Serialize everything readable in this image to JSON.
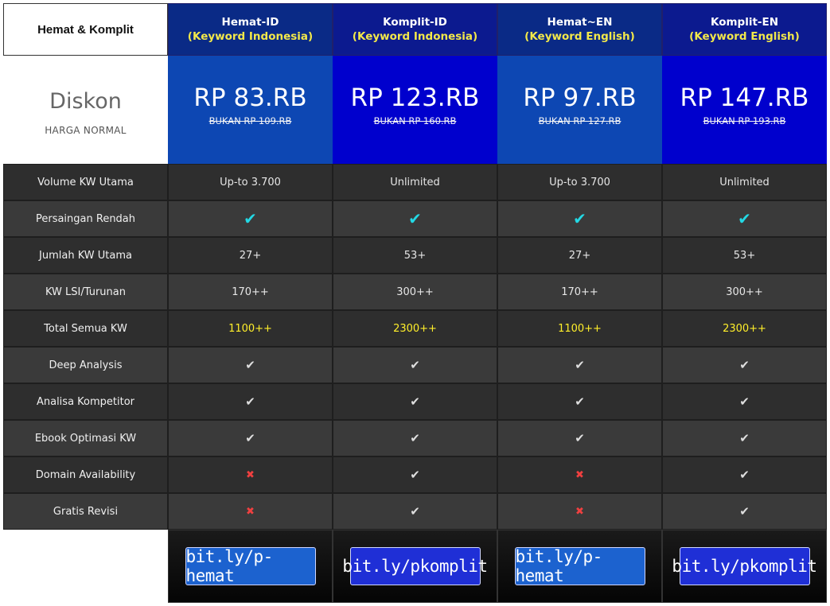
{
  "table": {
    "corner_label": "Hemat & Komplit",
    "plans": [
      {
        "name": "Hemat-ID",
        "sub": "(Keyword Indonesia)",
        "head_color": "#0a2a86",
        "price": "RP 83.RB",
        "old_price": "BUKAN RP 109.RB",
        "price_color": "#0d47b3",
        "link": "bit.ly/p-hemat",
        "btn_color": "#1c62cf"
      },
      {
        "name": "Komplit-ID",
        "sub": "(Keyword Indonesia)",
        "head_color": "#0c1a8f",
        "price": "RP 123.RB",
        "old_price": "BUKAN RP 160.RB",
        "price_color": "#0000cd",
        "link": "bit.ly/pkomplit",
        "btn_color": "#1f2fd6"
      },
      {
        "name": "Hemat~EN",
        "sub": "(Keyword English)",
        "head_color": "#0a2a86",
        "price": "RP 97.RB",
        "old_price": "BUKAN RP 127.RB",
        "price_color": "#0d47b3",
        "link": "bit.ly/p-hemat",
        "btn_color": "#1c62cf"
      },
      {
        "name": "Komplit-EN",
        "sub": "(Keyword English)",
        "head_color": "#0c1a8f",
        "price": "RP 147.RB",
        "old_price": "BUKAN RP 193.RB",
        "price_color": "#0000cd",
        "link": "bit.ly/pkomplit",
        "btn_color": "#1f2fd6"
      }
    ],
    "price_label": {
      "title": "Diskon",
      "subtitle": "HARGA NORMAL"
    },
    "features": [
      {
        "label": "Volume KW Utama",
        "values": [
          {
            "type": "text",
            "v": "Up-to 3.700"
          },
          {
            "type": "text",
            "v": "Unlimited"
          },
          {
            "type": "text",
            "v": "Up-to 3.700"
          },
          {
            "type": "text",
            "v": "Unlimited"
          }
        ]
      },
      {
        "label": "Persaingan Rendah",
        "values": [
          {
            "type": "check-cyan"
          },
          {
            "type": "check-cyan"
          },
          {
            "type": "check-cyan"
          },
          {
            "type": "check-cyan"
          }
        ]
      },
      {
        "label": "Jumlah KW Utama",
        "values": [
          {
            "type": "text",
            "v": "27+"
          },
          {
            "type": "text",
            "v": "53+"
          },
          {
            "type": "text",
            "v": "27+"
          },
          {
            "type": "text",
            "v": "53+"
          }
        ]
      },
      {
        "label": "KW LSI/Turunan",
        "values": [
          {
            "type": "text",
            "v": "170++"
          },
          {
            "type": "text",
            "v": "300++"
          },
          {
            "type": "text",
            "v": "170++"
          },
          {
            "type": "text",
            "v": "300++"
          }
        ]
      },
      {
        "label": "Total Semua KW",
        "values": [
          {
            "type": "yellow",
            "v": "1100++"
          },
          {
            "type": "yellow",
            "v": "2300++"
          },
          {
            "type": "yellow",
            "v": "1100++"
          },
          {
            "type": "yellow",
            "v": "2300++"
          }
        ]
      },
      {
        "label": "Deep Analysis",
        "values": [
          {
            "type": "check"
          },
          {
            "type": "check"
          },
          {
            "type": "check"
          },
          {
            "type": "check"
          }
        ]
      },
      {
        "label": "Analisa Kompetitor",
        "values": [
          {
            "type": "check"
          },
          {
            "type": "check"
          },
          {
            "type": "check"
          },
          {
            "type": "check"
          }
        ]
      },
      {
        "label": "Ebook Optimasi KW",
        "values": [
          {
            "type": "check"
          },
          {
            "type": "check"
          },
          {
            "type": "check"
          },
          {
            "type": "check"
          }
        ]
      },
      {
        "label": "Domain Availability",
        "values": [
          {
            "type": "cross"
          },
          {
            "type": "check"
          },
          {
            "type": "cross"
          },
          {
            "type": "check"
          }
        ]
      },
      {
        "label": "Gratis Revisi",
        "values": [
          {
            "type": "cross"
          },
          {
            "type": "check"
          },
          {
            "type": "cross"
          },
          {
            "type": "check"
          }
        ]
      }
    ],
    "icons": {
      "check": "check-icon",
      "cross": "cross-icon"
    }
  }
}
